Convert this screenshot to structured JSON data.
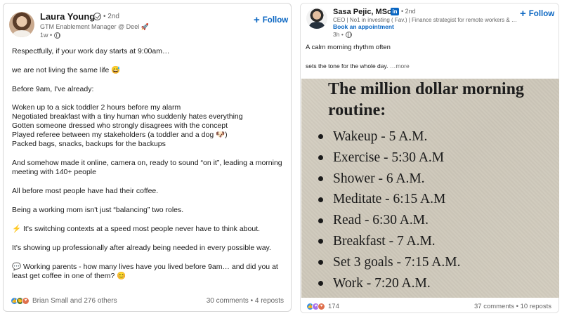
{
  "left_post": {
    "author": {
      "name": "Laura Young",
      "degree": "• 2nd",
      "headline": "GTM Enablement Manager @ Deel 🚀",
      "time": "1w •"
    },
    "follow_label": "Follow",
    "body": [
      "Respectfully, if your work day starts at 9:00am…",
      "we are not living the same life 😅",
      "Before 9am, I've already:",
      "Woken up to a sick toddler 2 hours before my alarm",
      "Negotiated breakfast with a tiny human who suddenly hates everything",
      "Gotten someone dressed who strongly disagrees with the concept",
      "Played referee between my stakeholders (a toddler and a dog 🐶)",
      "Packed bags, snacks, backups for the backups",
      "And somehow made it online, camera on, ready to sound “on it”, leading a morning meeting with 140+ people",
      "All before most people have had their coffee.",
      "Being a working mom isn't just “balancing” two roles.",
      "⚡ It's switching contexts at a speed most people never have to think about.",
      "It's showing up professionally after already being needed in every possible way.",
      "💬 Working parents - how many lives have you lived before 9am… and did you at least get coffee in one of them? 😊"
    ],
    "reactions": {
      "names": "Brian Small and 276 others",
      "comments": "30 comments",
      "separator": "•",
      "reposts": "4 reposts"
    }
  },
  "right_post": {
    "author": {
      "name": "Sasa Pejic, MSc",
      "degree": "• 2nd",
      "headline": "CEO | No1 in investing ( Fav.) | Finance strategist for remote workers & …",
      "time": "3h •"
    },
    "linkedin_badge": "in",
    "book_link": "Book an appointment",
    "follow_label": "Follow",
    "text_line_1": "A calm morning rhythm often",
    "text_line_2": "sets the tone for the whole day.",
    "more_label": "…more",
    "image": {
      "title": "The million dollar morning routine:",
      "items": [
        "Wakeup - 5 A.M.",
        "Exercise - 5:30 A.M",
        "Shower - 6 A.M.",
        "Meditate - 6:15 A.M",
        "Read - 6:30 A.M.",
        "Breakfast - 7 A.M.",
        "Set 3 goals - 7:15 A.M.",
        "Work - 7:20 A.M."
      ]
    },
    "reactions": {
      "count": "174",
      "comments": "37 comments",
      "separator": "•",
      "reposts": "10 reposts"
    }
  },
  "colors": {
    "link_blue": "#0a66c2",
    "muted_text": "#666666",
    "like": "#378fe9",
    "celebrate": "#44712e",
    "love": "#df704d",
    "support": "#a872e8"
  }
}
